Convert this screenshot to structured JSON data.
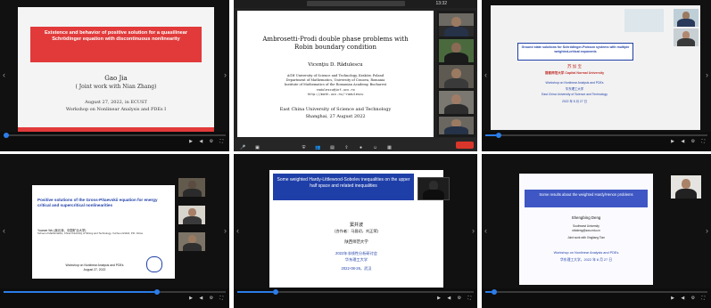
{
  "panel1": {
    "title": "Existence and behavior of positive solution for a quasilinear Schrödinger equation with discontinuous nonlinearity",
    "author": "Gao Jia",
    "coauthor": "( Joint work with Nian Zhang)",
    "date": "August 27, 2022, in ECUST",
    "event": "Workshop on Nonlinear Analysis and PDEs I"
  },
  "panel2": {
    "title": "Ambrosetti-Prodi double phase problems with Robin boundary condition",
    "author": "Vicenţiu D. Rădulescu",
    "affil1": "AGH University of Science and Technology, Kraków, Poland",
    "affil2": "Department of Mathematics, University of Craiova, Romania",
    "affil3": "Institute of Mathematics of the Romanian Academy, Bucharest",
    "email": "radulescu@inf.ucv.ro",
    "web": "http://math.ucv.ro/~radulescu",
    "venue": "East China University of Science and Technology",
    "place_date": "Shanghai, 27 August 2022",
    "zoom_clock": "13:32"
  },
  "panel3": {
    "title": "Ground state solutions for Schrödinger-Poisson systems with multiple weighted-critical exponents",
    "speaker_cn": "苏 加 宝",
    "univ_cn": "首都师范大学 Capital Normal University",
    "event": "Workshop on Nonlinear Analysis and PDEs",
    "host_cn": "华东理工大学",
    "host_en": "East China University of Science and Technology",
    "date_cn": "2022 年 8 月 27 日"
  },
  "panel4": {
    "title": "Positive solutions of the Gross-Pitaevskii equation for energy critical and supercritical nonlinearities",
    "author": "Yuanze Wu (吴元泽，中国矿业大学)",
    "affil": "School of Mathematics, China University of Mining and Technology, Xuzhou 221116, P.R. China",
    "event": "Workshop on Nonlinear Analysis and PDEs",
    "date": "August 27, 2022"
  },
  "panel5": {
    "title": "Some weighted Hardy-Littlewood-Sobolev inequalities on the upper half space and related inequalities",
    "speaker_cn": "窦井波",
    "coauthors_cn": "(合作者：马昌初，刘正荣)",
    "univ_cn": "陕西师范大学",
    "event_cn": "2022年非线性分析研讨会",
    "host_cn": "华东理工大学",
    "date_cn": "2022-08-26，武汉"
  },
  "panel6": {
    "title": "Some results about the weighted Hardy/Henon problems",
    "speaker": "Shengbing Deng",
    "univ": "Southwest University",
    "email": "shbdeng@swu.edu.cn",
    "joint": "Joint work with Xingliang Tian",
    "event": "Workshop on Nonlinear Analysis and PDEs",
    "date_cn": "华东理工大学，2022 年 8 月 27 日"
  },
  "colors": {
    "slide_blue": "#1f3fa8",
    "accent_red": "#c0312b",
    "progress": "#2b7de9"
  }
}
